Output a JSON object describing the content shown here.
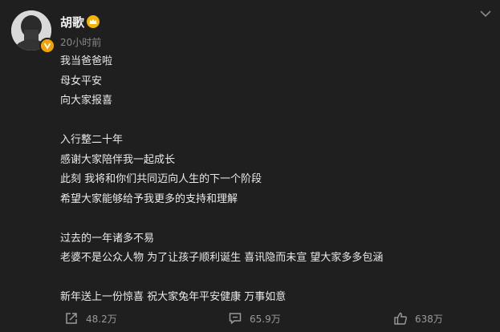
{
  "post": {
    "author": {
      "name": "胡歌",
      "verified": true,
      "vip_crown": true
    },
    "timestamp": "20小时前",
    "lines": [
      "我当爸爸啦",
      "母女平安",
      "向大家报喜",
      "",
      "入行整二十年",
      "感谢大家陪伴我一起成长",
      "此刻 我将和你们共同迈向人生的下一个阶段",
      "希望大家能够给予我更多的支持和理解",
      "",
      "过去的一年诸多不易",
      "老婆不是公众人物 为了让孩子顺利诞生 喜讯隐而未宣 望大家多多包涵",
      "",
      "新年送上一份惊喜 祝大家兔年平安健康 万事如意"
    ],
    "actions": {
      "share": {
        "icon": "share-icon",
        "count": "48.2万"
      },
      "comment": {
        "icon": "comment-icon",
        "count": "65.9万"
      },
      "like": {
        "icon": "thumbs-up-icon",
        "count": "638万"
      }
    }
  },
  "colors": {
    "background": "#1f1f1f",
    "text": "#e9e9e9",
    "muted": "#8a8a8a",
    "badge": "#f2a300"
  }
}
